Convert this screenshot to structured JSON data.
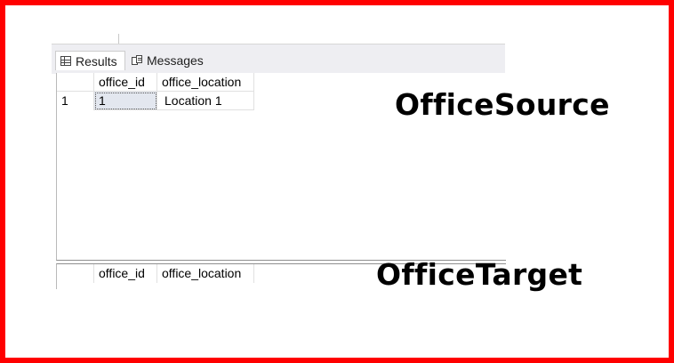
{
  "toolbar_fragment": "",
  "tabs": {
    "results": "Results",
    "messages": "Messages"
  },
  "grid1": {
    "columns": [
      "office_id",
      "office_location"
    ],
    "rows": [
      {
        "row_number": "1",
        "office_id": "1",
        "office_location": "Location 1"
      }
    ]
  },
  "grid2": {
    "columns": [
      "office_id",
      "office_location"
    ],
    "rows": []
  },
  "captions": {
    "source": "OfficeSource",
    "target": "OfficeTarget"
  },
  "colors": {
    "frame_border": "#ff0000",
    "tab_bar": "#eeeef2",
    "selected_cell": "#e3e7ef"
  }
}
